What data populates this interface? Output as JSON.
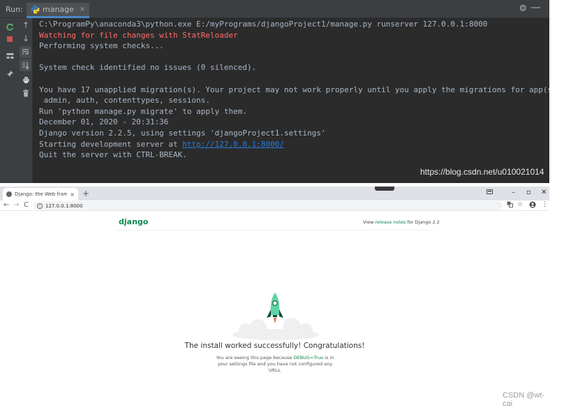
{
  "ide": {
    "run_label": "Run:",
    "tab_label": "manage",
    "tab_close": "×",
    "gear": "⚙",
    "minimize": "—",
    "console_lines": [
      {
        "text": "C:\\ProgramPy\\anaconda3\\python.exe E:/myPrograms/djangoProject1/manage.py runserver 127.0.0.1:8000",
        "kind": "normal"
      },
      {
        "text": "Watching for file changes with StatReloader",
        "kind": "warn"
      },
      {
        "text": "Performing system checks...",
        "kind": "normal"
      },
      {
        "text": "",
        "kind": "normal"
      },
      {
        "text": "System check identified no issues (0 silenced).",
        "kind": "normal"
      },
      {
        "text": "",
        "kind": "normal"
      },
      {
        "text": "You have 17 unapplied migration(s). Your project may not work properly until you apply the migrations for app(s):",
        "kind": "normal"
      },
      {
        "text": " admin, auth, contenttypes, sessions.",
        "kind": "normal"
      },
      {
        "text": "Run 'python manage.py migrate' to apply them.",
        "kind": "normal"
      },
      {
        "text": "December 01, 2020 - 20:31:36",
        "kind": "normal"
      },
      {
        "text": "Django version 2.2.5, using settings 'djangoProject1.settings'",
        "kind": "normal"
      },
      {
        "text": "Starting development server at ",
        "kind": "normal",
        "link": "http://127.0.0.1:8000/"
      },
      {
        "text": "Quit the server with CTRL-BREAK.",
        "kind": "normal"
      }
    ],
    "watermark": "https://blog.csdn.net/u010021014"
  },
  "browser": {
    "tab_title": "Django: the Web framework f",
    "tab_close": "×",
    "new_tab": "+",
    "win_minimize": "–",
    "win_maximize": "▫",
    "win_close": "✕",
    "back": "←",
    "forward": "→",
    "reload": "C",
    "url": "127.0.0.1:8000",
    "star": "☆",
    "menu": "⋮"
  },
  "django": {
    "logo": "django",
    "release_prefix": "View ",
    "release_link": "release notes",
    "release_suffix": " for Django 2.2",
    "congrats": "The install worked successfully! Congratulations!",
    "sub_prefix": "You are seeing this page because ",
    "sub_debug": "DEBUG=True",
    "sub_suffix": " is in your settings file and you have not configured any URLs."
  },
  "watermark2": "CSDN @wt-cai",
  "colors": {
    "ide_bg": "#2b2b2b",
    "ide_text": "#a9b7c6",
    "ide_warn": "#ff6b68",
    "ide_link": "#287bde",
    "django_green": "#0c8a4e",
    "rocket_body": "#5fd3a5"
  }
}
